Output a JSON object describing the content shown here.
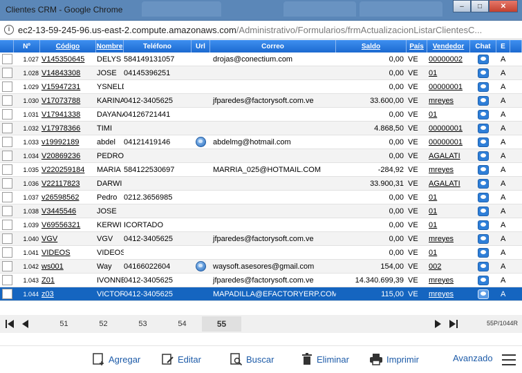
{
  "window": {
    "title": "Clientes CRM - Google Chrome",
    "controls": {
      "minimize": "–",
      "maximize": "□",
      "close": "✕"
    }
  },
  "address": {
    "host": "ec2-13-59-245-96.us-east-2.compute.amazonaws.com",
    "path": "/Administrativo/Formularios/frmActualizacionListarClientesC..."
  },
  "columns": {
    "num": "Nº",
    "codigo": "Código",
    "nombre": "Nombre",
    "telefono": "Teléfono",
    "url": "Url",
    "correo": "Correo",
    "saldo": "Saldo",
    "pais": "País",
    "vendedor": "Vendedor",
    "chat": "Chat",
    "e": "E"
  },
  "rows": [
    {
      "n": "1.027",
      "codigo": "V145350645",
      "nombre": "DELYS",
      "telefono": "584149131057",
      "url": false,
      "correo": "drojas@conectium.com",
      "saldo": "0,00",
      "pais": "VE",
      "vendedor": "00000002",
      "e": "A"
    },
    {
      "n": "1.028",
      "codigo": "V14843308",
      "nombre": "JOSE",
      "telefono": "04145396251",
      "url": false,
      "correo": "",
      "saldo": "0,00",
      "pais": "VE",
      "vendedor": "01",
      "e": "A"
    },
    {
      "n": "1.029",
      "codigo": "V15947231",
      "nombre": "YSNELD",
      "telefono": "",
      "url": false,
      "correo": "",
      "saldo": "0,00",
      "pais": "VE",
      "vendedor": "00000001",
      "e": "A"
    },
    {
      "n": "1.030",
      "codigo": "V17073788",
      "nombre": "KARINA",
      "telefono": "0412-3405625",
      "url": false,
      "correo": "jfparedes@factorysoft.com.ve",
      "saldo": "33.600,00",
      "pais": "VE",
      "vendedor": "mreyes",
      "e": "A"
    },
    {
      "n": "1.031",
      "codigo": "V17941338",
      "nombre": "DAYANA",
      "telefono": "04126721441",
      "url": false,
      "correo": "",
      "saldo": "0,00",
      "pais": "VE",
      "vendedor": "01",
      "e": "A"
    },
    {
      "n": "1.032",
      "codigo": "V17978366",
      "nombre": "TIMI",
      "telefono": "",
      "url": false,
      "correo": "",
      "saldo": "4.868,50",
      "pais": "VE",
      "vendedor": "00000001",
      "e": "A"
    },
    {
      "n": "1.033",
      "codigo": "v19992189",
      "nombre": "abdel",
      "telefono": "04121419146",
      "url": true,
      "correo": "abdelmg@hotmail.com",
      "saldo": "0,00",
      "pais": "VE",
      "vendedor": "00000001",
      "e": "A"
    },
    {
      "n": "1.034",
      "codigo": "V20869236",
      "nombre": "PEDRO",
      "telefono": "",
      "url": false,
      "correo": "",
      "saldo": "0,00",
      "pais": "VE",
      "vendedor": "AGALATI",
      "e": "A"
    },
    {
      "n": "1.035",
      "codigo": "V220259184",
      "nombre": "MARIA",
      "telefono": "584122530697",
      "url": false,
      "correo": "MARRIA_025@HOTMAIL.COM",
      "saldo": "-284,92",
      "pais": "VE",
      "vendedor": "mreyes",
      "e": "A"
    },
    {
      "n": "1.036",
      "codigo": "V22117823",
      "nombre": "DARWI",
      "telefono": "",
      "url": false,
      "correo": "",
      "saldo": "33.900,31",
      "pais": "VE",
      "vendedor": "AGALATI",
      "e": "A"
    },
    {
      "n": "1.037",
      "codigo": "v26598562",
      "nombre": "Pedro",
      "telefono": "0212.3656985",
      "url": false,
      "correo": "",
      "saldo": "0,00",
      "pais": "VE",
      "vendedor": "01",
      "e": "A"
    },
    {
      "n": "1.038",
      "codigo": "V3445546",
      "nombre": "JOSE",
      "telefono": "",
      "url": false,
      "correo": "",
      "saldo": "0,00",
      "pais": "VE",
      "vendedor": "01",
      "e": "A"
    },
    {
      "n": "1.039",
      "codigo": "V69556321",
      "nombre": "KERWI",
      "telefono": "ICORTADO",
      "url": false,
      "correo": "",
      "saldo": "0,00",
      "pais": "VE",
      "vendedor": "01",
      "e": "A"
    },
    {
      "n": "1.040",
      "codigo": "VGV",
      "nombre": "VGV",
      "telefono": "0412-3405625",
      "url": false,
      "correo": "jfparedes@factorysoft.com.ve",
      "saldo": "0,00",
      "pais": "VE",
      "vendedor": "mreyes",
      "e": "A"
    },
    {
      "n": "1.041",
      "codigo": "VIDEOS",
      "nombre": "VIDEOS",
      "telefono": "",
      "url": false,
      "correo": "",
      "saldo": "0,00",
      "pais": "VE",
      "vendedor": "01",
      "e": "A"
    },
    {
      "n": "1.042",
      "codigo": "ws001",
      "nombre": "Way",
      "telefono": "04166022604",
      "url": true,
      "correo": "waysoft.asesores@gmail.com",
      "saldo": "154,00",
      "pais": "VE",
      "vendedor": "002",
      "e": "A"
    },
    {
      "n": "1.043",
      "codigo": "Z01",
      "nombre": "IVONNE",
      "telefono": "0412-3405625",
      "url": false,
      "correo": "jfparedes@factorysoft.com.ve",
      "saldo": "14.340.699,39",
      "pais": "VE",
      "vendedor": "mreyes",
      "e": "A"
    },
    {
      "n": "1.044",
      "codigo": "z03",
      "nombre": "VICTOR",
      "telefono": "0412-3405625",
      "url": false,
      "correo": "MAPADILLA@EFACTORYERP.COM",
      "saldo": "115,00",
      "pais": "VE",
      "vendedor": "mreyes",
      "e": "A",
      "selected": true
    }
  ],
  "pager": {
    "pages": [
      "51",
      "52",
      "53",
      "54",
      "55"
    ],
    "current": "55",
    "info": "55P/1044R"
  },
  "toolbar": {
    "agregar": "Agregar",
    "editar": "Editar",
    "buscar": "Buscar",
    "eliminar": "Eliminar",
    "imprimir": "Imprimir",
    "avanzado": "Avanzado"
  },
  "colors": {
    "header": "#1c6ad0",
    "selected": "#1565c0",
    "link": "#1d5ba8"
  }
}
